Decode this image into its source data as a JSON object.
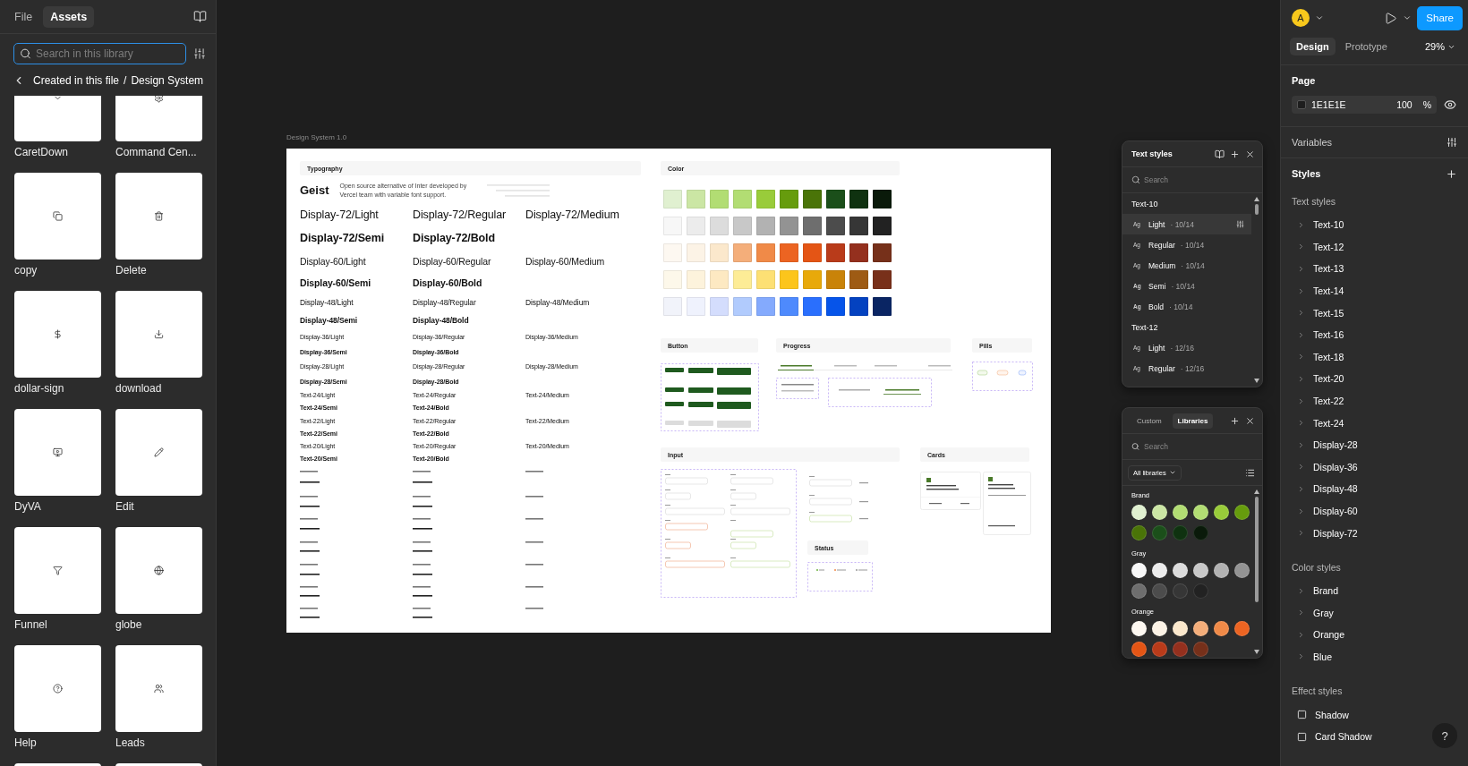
{
  "left_panel": {
    "tabs": [
      {
        "label": "File",
        "selected": false
      },
      {
        "label": "Assets",
        "selected": true
      }
    ],
    "search": {
      "placeholder": "Search in this library"
    },
    "breadcrumb": {
      "parent": "Created in this file",
      "separator": "/",
      "current": "Design System"
    },
    "assets": [
      {
        "label": "CaretDown"
      },
      {
        "label": "Command Cen..."
      },
      {
        "label": "copy"
      },
      {
        "label": "Delete"
      },
      {
        "label": "dollar-sign"
      },
      {
        "label": "download"
      },
      {
        "label": "DyVA"
      },
      {
        "label": "Edit"
      },
      {
        "label": "Funnel"
      },
      {
        "label": "globe"
      },
      {
        "label": "Help"
      },
      {
        "label": "Leads"
      }
    ]
  },
  "canvas": {
    "frame_label": "Design System 1.0",
    "typography": {
      "header": "Typography",
      "font_name": "Geist",
      "description": "Open source alternative of Inter developed by Vercel team with variable font support.",
      "rows": [
        [
          {
            "text": "Display-72/Light",
            "kind": "light"
          },
          {
            "text": "Display-72/Regular",
            "kind": "regular"
          },
          {
            "text": "Display-72/Medium",
            "kind": "medium"
          }
        ],
        [
          {
            "text": "Display-72/Semi",
            "kind": "semi"
          },
          {
            "text": "Display-72/Bold",
            "kind": "bold"
          }
        ],
        [
          {
            "text": "Display-60/Light",
            "kind": "light"
          },
          {
            "text": "Display-60/Regular",
            "kind": "regular"
          },
          {
            "text": "Display-60/Medium",
            "kind": "medium"
          }
        ],
        [
          {
            "text": "Display-60/Semi",
            "kind": "semi"
          },
          {
            "text": "Display-60/Bold",
            "kind": "bold"
          }
        ],
        [
          {
            "text": "Display-48/Light",
            "kind": "light"
          },
          {
            "text": "Display-48/Regular",
            "kind": "regular"
          },
          {
            "text": "Display-48/Medium",
            "kind": "medium"
          }
        ],
        [
          {
            "text": "Display-48/Semi",
            "kind": "semi"
          },
          {
            "text": "Display-48/Bold",
            "kind": "bold"
          }
        ],
        [
          {
            "text": "Display-36/Light",
            "kind": "light"
          },
          {
            "text": "Display-36/Regular",
            "kind": "regular"
          },
          {
            "text": "Display-36/Medium",
            "kind": "medium"
          }
        ],
        [
          {
            "text": "Display-36/Semi",
            "kind": "semi"
          },
          {
            "text": "Display-36/Bold",
            "kind": "bold"
          }
        ],
        [
          {
            "text": "Display-28/Light",
            "kind": "light"
          },
          {
            "text": "Display-28/Regular",
            "kind": "regular"
          },
          {
            "text": "Display-28/Medium",
            "kind": "medium"
          }
        ],
        [
          {
            "text": "Display-28/Semi",
            "kind": "semi"
          },
          {
            "text": "Display-28/Bold",
            "kind": "bold"
          }
        ],
        [
          {
            "text": "Text-24/Light",
            "kind": "light"
          },
          {
            "text": "Text-24/Regular",
            "kind": "regular"
          },
          {
            "text": "Text-24/Medium",
            "kind": "medium"
          }
        ],
        [
          {
            "text": "Text-24/Semi",
            "kind": "semi"
          },
          {
            "text": "Text-24/Bold",
            "kind": "bold"
          }
        ],
        [
          {
            "text": "Text-22/Light",
            "kind": "light"
          },
          {
            "text": "Text-22/Regular",
            "kind": "regular"
          },
          {
            "text": "Text-22/Medium",
            "kind": "medium"
          }
        ],
        [
          {
            "text": "Text-22/Semi",
            "kind": "semi"
          },
          {
            "text": "Text-22/Bold",
            "kind": "bold"
          }
        ],
        [
          {
            "text": "Text-20/Light",
            "kind": "light"
          },
          {
            "text": "Text-20/Regular",
            "kind": "regular"
          },
          {
            "text": "Text-20/Medium",
            "kind": "medium"
          }
        ],
        [
          {
            "text": "Text-20/Semi",
            "kind": "semi"
          },
          {
            "text": "Text-20/Bold",
            "kind": "bold"
          }
        ]
      ]
    },
    "color": {
      "header": "Color",
      "rows": [
        [
          {
            "color": "#e0f0d0"
          },
          {
            "color": "#cbe6a4"
          },
          {
            "color": "#b2dd73"
          },
          {
            "color": "#b2dd73"
          },
          {
            "color": "#99cc3a"
          },
          {
            "color": "#669c0d"
          },
          {
            "color": "#4a7408"
          },
          {
            "color": "#1b4f1a"
          },
          {
            "color": "#0f3210"
          },
          {
            "color": "#0a1a0a"
          }
        ],
        [
          {
            "color": "#f7f7f7"
          },
          {
            "color": "#ececec"
          },
          {
            "color": "#dcdcdc"
          },
          {
            "color": "#c8c8c8"
          },
          {
            "color": "#b2b2b2"
          },
          {
            "color": "#939393"
          },
          {
            "color": "#6e6e6e"
          },
          {
            "color": "#4c4c4c"
          },
          {
            "color": "#363636"
          },
          {
            "color": "#222222"
          }
        ],
        [
          {
            "color": "#fdf8f1"
          },
          {
            "color": "#fcf3e6"
          },
          {
            "color": "#fbe8cc"
          },
          {
            "color": "#f4ae7a"
          },
          {
            "color": "#f08a48"
          },
          {
            "color": "#ec6422"
          },
          {
            "color": "#e45515"
          },
          {
            "color": "#b93b1a"
          },
          {
            "color": "#94301e"
          },
          {
            "color": "#76301a"
          }
        ],
        [
          {
            "color": "#fdf8ea"
          },
          {
            "color": "#fdf3dc"
          },
          {
            "color": "#fde9c2"
          },
          {
            "color": "#fdec96"
          },
          {
            "color": "#fde074"
          },
          {
            "color": "#fcc51c"
          },
          {
            "color": "#e8a90a"
          },
          {
            "color": "#c98309"
          },
          {
            "color": "#9e5b14"
          },
          {
            "color": "#78301a"
          }
        ],
        [
          {
            "color": "#f1f3fa"
          },
          {
            "color": "#eff2fd"
          },
          {
            "color": "#d4ddfd"
          },
          {
            "color": "#b1cbfd"
          },
          {
            "color": "#84aafd"
          },
          {
            "color": "#4e8afd"
          },
          {
            "color": "#2a6ffd"
          },
          {
            "color": "#0654e9"
          },
          {
            "color": "#0442c0"
          },
          {
            "color": "#0a2563"
          }
        ]
      ]
    },
    "sections": {
      "button": "Button",
      "progress": "Progress",
      "pills": "Pills",
      "input": "Input",
      "status": "Status",
      "cards": "Cards"
    }
  },
  "text_styles_panel": {
    "title": "Text styles",
    "search": {
      "placeholder": "Search"
    },
    "groups": [
      {
        "name": "Text-10",
        "items": [
          {
            "sample": "Ag",
            "name": "Light",
            "spec": "· 10/14",
            "kind": "light",
            "selected": true
          },
          {
            "sample": "Ag",
            "name": "Regular",
            "spec": "· 10/14",
            "kind": "regular",
            "selected": false
          },
          {
            "sample": "Ag",
            "name": "Medium",
            "spec": "· 10/14",
            "kind": "medium",
            "selected": false
          },
          {
            "sample": "Ag",
            "name": "Semi",
            "spec": "· 10/14",
            "kind": "semi",
            "selected": false
          },
          {
            "sample": "Ag",
            "name": "Bold",
            "spec": "· 10/14",
            "kind": "bold",
            "selected": false
          }
        ]
      },
      {
        "name": "Text-12",
        "items": [
          {
            "sample": "Ag",
            "name": "Light",
            "spec": "· 12/16",
            "kind": "light",
            "selected": false
          },
          {
            "sample": "Ag",
            "name": "Regular",
            "spec": "· 12/16",
            "kind": "regular",
            "selected": false
          }
        ]
      }
    ]
  },
  "libraries_panel": {
    "tabs": [
      {
        "label": "Custom",
        "selected": false
      },
      {
        "label": "Libraries",
        "selected": true
      }
    ],
    "search": {
      "placeholder": "Search"
    },
    "filter": "All libraries",
    "groups": [
      {
        "name": "Brand",
        "colors": [
          {
            "color": "#e0f0d0"
          },
          {
            "color": "#cbe6a4"
          },
          {
            "color": "#b2dd73"
          },
          {
            "color": "#b2dd73"
          },
          {
            "color": "#99cc3a"
          },
          {
            "color": "#669c0d"
          },
          {
            "color": "#4a7408"
          },
          {
            "color": "#1b4f1a"
          },
          {
            "color": "#0f3210"
          },
          {
            "color": "#0a1a0a"
          }
        ]
      },
      {
        "name": "Gray",
        "colors": [
          {
            "color": "#f7f7f7"
          },
          {
            "color": "#ececec"
          },
          {
            "color": "#dcdcdc"
          },
          {
            "color": "#c8c8c8"
          },
          {
            "color": "#b2b2b2"
          },
          {
            "color": "#939393"
          },
          {
            "color": "#6e6e6e"
          },
          {
            "color": "#4c4c4c"
          },
          {
            "color": "#363636"
          },
          {
            "color": "#222222"
          }
        ]
      },
      {
        "name": "Orange",
        "colors": [
          {
            "color": "#fdf8f1"
          },
          {
            "color": "#fcf3e6"
          },
          {
            "color": "#fbe8cc"
          },
          {
            "color": "#f4ae7a"
          },
          {
            "color": "#f08a48"
          },
          {
            "color": "#ec6422"
          },
          {
            "color": "#e45515"
          },
          {
            "color": "#b93b1a"
          },
          {
            "color": "#94301e"
          },
          {
            "color": "#76301a"
          }
        ]
      }
    ]
  },
  "right_panel": {
    "avatar": "A",
    "share": "Share",
    "tabs": [
      {
        "label": "Design",
        "selected": true
      },
      {
        "label": "Prototype",
        "selected": false
      }
    ],
    "zoom": "29%",
    "page": {
      "title": "Page",
      "color": "1E1E1E",
      "opacity": "100",
      "unit": "%"
    },
    "variables": "Variables",
    "styles": "Styles",
    "text_styles": {
      "title": "Text styles",
      "items": [
        "Text-10",
        "Text-12",
        "Text-13",
        "Text-14",
        "Text-15",
        "Text-16",
        "Text-18",
        "Text-20",
        "Text-22",
        "Text-24",
        "Display-28",
        "Display-36",
        "Display-48",
        "Display-60",
        "Display-72"
      ]
    },
    "color_styles": {
      "title": "Color styles",
      "items": [
        "Brand",
        "Gray",
        "Orange",
        "Blue"
      ]
    },
    "effect_styles": {
      "title": "Effect styles",
      "items": [
        "Shadow",
        "Card Shadow"
      ]
    },
    "help": "?"
  }
}
